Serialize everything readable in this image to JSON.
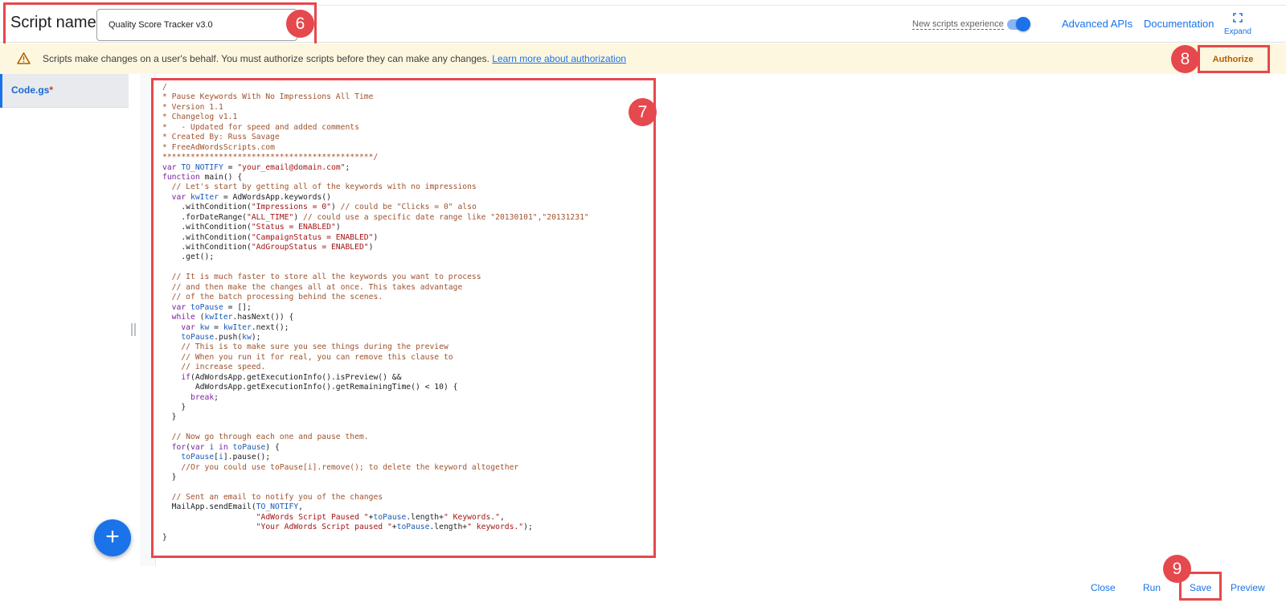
{
  "header": {
    "script_name_label": "Script name:",
    "script_name_value": "Quality Score Tracker v3.0",
    "new_experience_label": "New scripts experience",
    "new_experience_on": true,
    "advanced_apis": "Advanced APIs",
    "documentation": "Documentation",
    "expand": "Expand",
    "expand_icon": "fullscreen-icon"
  },
  "banner": {
    "icon": "warning-icon",
    "text": "Scripts make changes on a user's behalf. You must authorize scripts before they can make any changes.",
    "link": "Learn more about authorization",
    "authorize": "Authorize"
  },
  "sidebar": {
    "file_name": "Code.gs",
    "modified_marker": "*",
    "add_icon": "plus-icon"
  },
  "annotations": {
    "b6": "6",
    "b7": "7",
    "b8": "8",
    "b9": "9"
  },
  "editor": {
    "lines": [
      [
        [
          "c-com",
          "/"
        ]
      ],
      [
        [
          "c-com",
          "* Pause Keywords With No Impressions All Time"
        ]
      ],
      [
        [
          "c-com",
          "* Version 1.1"
        ]
      ],
      [
        [
          "c-com",
          "* Changelog v1.1"
        ]
      ],
      [
        [
          "c-com",
          "*   - Updated for speed and added comments"
        ]
      ],
      [
        [
          "c-com",
          "* Created By: Russ Savage"
        ]
      ],
      [
        [
          "c-com",
          "* FreeAdWordsScripts.com"
        ]
      ],
      [
        [
          "c-com",
          "*********************************************/"
        ]
      ],
      [
        [
          "c-kw",
          "var "
        ],
        [
          "c-var",
          "TO_NOTIFY"
        ],
        [
          "c-plain",
          " = "
        ],
        [
          "c-str",
          "\"your_email@domain.com\""
        ],
        [
          "c-plain",
          ";"
        ]
      ],
      [
        [
          "c-kw",
          "function "
        ],
        [
          "c-plain",
          "main() {"
        ]
      ],
      [
        [
          "c-com",
          "  // Let's start by getting all of the keywords with no impressions"
        ]
      ],
      [
        [
          "c-kw",
          "  var "
        ],
        [
          "c-var",
          "kwIter"
        ],
        [
          "c-plain",
          " = AdWordsApp.keywords()"
        ]
      ],
      [
        [
          "c-plain",
          "    .withCondition("
        ],
        [
          "c-str",
          "\"Impressions = 0\""
        ],
        [
          "c-plain",
          ") "
        ],
        [
          "c-com",
          "// could be \"Clicks = 0\" also"
        ]
      ],
      [
        [
          "c-plain",
          "    .forDateRange("
        ],
        [
          "c-str",
          "\"ALL_TIME\""
        ],
        [
          "c-plain",
          ") "
        ],
        [
          "c-com",
          "// could use a specific date range like \"20130101\",\"20131231\""
        ]
      ],
      [
        [
          "c-plain",
          "    .withCondition("
        ],
        [
          "c-str",
          "\"Status = ENABLED\""
        ],
        [
          "c-plain",
          ")"
        ]
      ],
      [
        [
          "c-plain",
          "    .withCondition("
        ],
        [
          "c-str",
          "\"CampaignStatus = ENABLED\""
        ],
        [
          "c-plain",
          ")"
        ]
      ],
      [
        [
          "c-plain",
          "    .withCondition("
        ],
        [
          "c-str",
          "\"AdGroupStatus = ENABLED\""
        ],
        [
          "c-plain",
          ")"
        ]
      ],
      [
        [
          "c-plain",
          "    .get();"
        ]
      ],
      [
        [
          "c-plain",
          ""
        ]
      ],
      [
        [
          "c-com",
          "  // It is much faster to store all the keywords you want to process"
        ]
      ],
      [
        [
          "c-com",
          "  // and then make the changes all at once. This takes advantage"
        ]
      ],
      [
        [
          "c-com",
          "  // of the batch processing behind the scenes."
        ]
      ],
      [
        [
          "c-kw",
          "  var "
        ],
        [
          "c-var",
          "toPause"
        ],
        [
          "c-plain",
          " = [];"
        ]
      ],
      [
        [
          "c-kw",
          "  while "
        ],
        [
          "c-plain",
          "("
        ],
        [
          "c-var",
          "kwIter"
        ],
        [
          "c-plain",
          ".hasNext()) {"
        ]
      ],
      [
        [
          "c-kw",
          "    var "
        ],
        [
          "c-var",
          "kw"
        ],
        [
          "c-plain",
          " = "
        ],
        [
          "c-var",
          "kwIter"
        ],
        [
          "c-plain",
          ".next();"
        ]
      ],
      [
        [
          "c-var",
          "    toPause"
        ],
        [
          "c-plain",
          ".push("
        ],
        [
          "c-var",
          "kw"
        ],
        [
          "c-plain",
          ");"
        ]
      ],
      [
        [
          "c-com",
          "    // This is to make sure you see things during the preview"
        ]
      ],
      [
        [
          "c-com",
          "    // When you run it for real, you can remove this clause to"
        ]
      ],
      [
        [
          "c-com",
          "    // increase speed."
        ]
      ],
      [
        [
          "c-kw",
          "    if"
        ],
        [
          "c-plain",
          "(AdWordsApp.getExecutionInfo().isPreview() &&"
        ]
      ],
      [
        [
          "c-plain",
          "       AdWordsApp.getExecutionInfo().getRemainingTime() < 10) {"
        ]
      ],
      [
        [
          "c-kw",
          "      break"
        ],
        [
          "c-plain",
          ";"
        ]
      ],
      [
        [
          "c-plain",
          "    }"
        ]
      ],
      [
        [
          "c-plain",
          "  }"
        ]
      ],
      [
        [
          "c-plain",
          ""
        ]
      ],
      [
        [
          "c-com",
          "  // Now go through each one and pause them."
        ]
      ],
      [
        [
          "c-kw",
          "  for"
        ],
        [
          "c-plain",
          "("
        ],
        [
          "c-kw",
          "var "
        ],
        [
          "c-var",
          "i"
        ],
        [
          "c-kw",
          " in "
        ],
        [
          "c-var",
          "toPause"
        ],
        [
          "c-plain",
          ") {"
        ]
      ],
      [
        [
          "c-var",
          "    toPause"
        ],
        [
          "c-plain",
          "["
        ],
        [
          "c-var",
          "i"
        ],
        [
          "c-plain",
          "].pause();"
        ]
      ],
      [
        [
          "c-com",
          "    //Or you could use toPause[i].remove(); to delete the keyword altogether"
        ]
      ],
      [
        [
          "c-plain",
          "  }"
        ]
      ],
      [
        [
          "c-plain",
          ""
        ]
      ],
      [
        [
          "c-com",
          "  // Sent an email to notify you of the changes"
        ]
      ],
      [
        [
          "c-plain",
          "  MailApp.sendEmail("
        ],
        [
          "c-var",
          "TO_NOTIFY"
        ],
        [
          "c-plain",
          ","
        ]
      ],
      [
        [
          "c-plain",
          "                    "
        ],
        [
          "c-str",
          "\"AdWords Script Paused \""
        ],
        [
          "c-plain",
          "+"
        ],
        [
          "c-var",
          "toPause"
        ],
        [
          "c-plain",
          ".length+"
        ],
        [
          "c-str",
          "\" Keywords.\""
        ],
        [
          "c-plain",
          ","
        ]
      ],
      [
        [
          "c-plain",
          "                    "
        ],
        [
          "c-str",
          "\"Your AdWords Script paused \""
        ],
        [
          "c-plain",
          "+"
        ],
        [
          "c-var",
          "toPause"
        ],
        [
          "c-plain",
          ".length+"
        ],
        [
          "c-str",
          "\" keywords.\""
        ],
        [
          "c-plain",
          ");"
        ]
      ],
      [
        [
          "c-plain",
          "}"
        ]
      ]
    ]
  },
  "footer": {
    "close": "Close",
    "run": "Run",
    "save": "Save",
    "preview": "Preview"
  }
}
